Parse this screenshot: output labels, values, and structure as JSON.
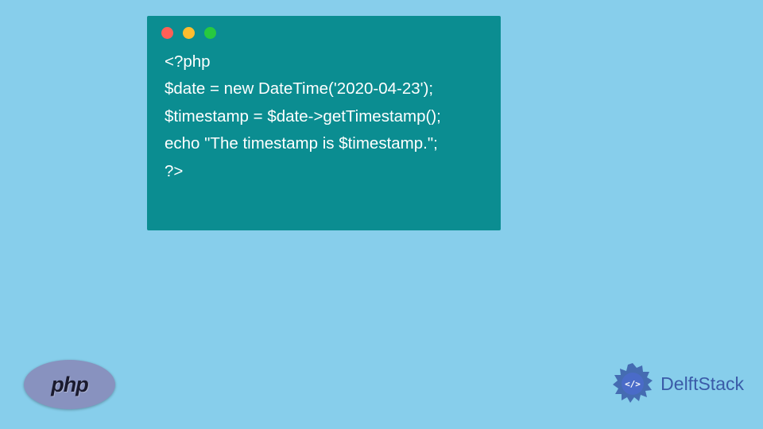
{
  "code": {
    "line1": "<?php",
    "line2": "$date = new DateTime('2020-04-23');",
    "line3": "$timestamp = $date->getTimestamp();",
    "line4": "echo \"The timestamp is $timestamp.\";",
    "line5": "?>"
  },
  "logos": {
    "php": "php",
    "delft": "DelftStack"
  }
}
